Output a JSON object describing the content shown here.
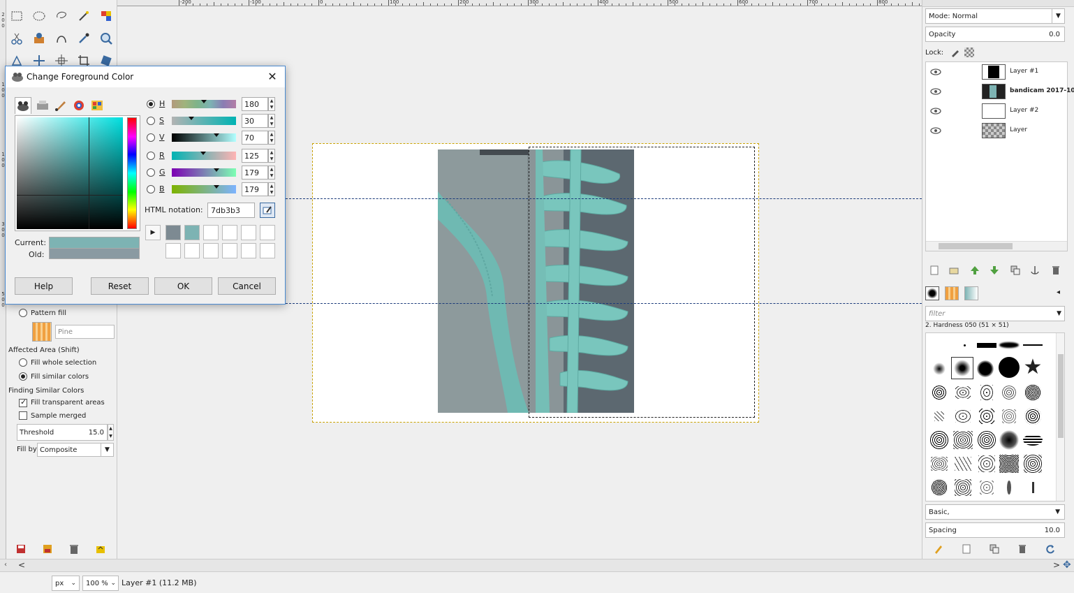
{
  "ruler": {
    "h_ticks": [
      "-200",
      "-100",
      "0",
      "100",
      "200",
      "300",
      "400",
      "500",
      "600",
      "700",
      "800"
    ],
    "v_ticks": [
      "2",
      "0",
      "0",
      "1",
      "0",
      "0",
      "1",
      "0",
      "0",
      "3",
      "0",
      "0",
      "5",
      "0",
      "0"
    ]
  },
  "dialog": {
    "title": "Change Foreground Color",
    "close": "✕",
    "sliders": [
      {
        "label": "H",
        "value": "180",
        "checked": true
      },
      {
        "label": "S",
        "value": "30",
        "checked": false
      },
      {
        "label": "V",
        "value": "70",
        "checked": false
      },
      {
        "label": "R",
        "value": "125",
        "checked": false
      },
      {
        "label": "G",
        "value": "179",
        "checked": false
      },
      {
        "label": "B",
        "value": "179",
        "checked": false
      }
    ],
    "html_notation_label": "HTML notation:",
    "html_notation_value": "7db3b3",
    "current_label": "Current:",
    "old_label": "Old:",
    "current_color": "#7db3b3",
    "old_color": "#8a9aa2",
    "history_colors": [
      "#7d8a92",
      "#7db3b3"
    ],
    "buttons": {
      "help": "Help",
      "reset": "Reset",
      "ok": "OK",
      "cancel": "Cancel"
    }
  },
  "toolbox": {
    "pattern_fill": "Pattern fill",
    "pattern_name": "Pine",
    "affected_area": "Affected Area  (Shift)",
    "fill_whole": "Fill whole selection",
    "fill_similar": "Fill similar colors",
    "finding_similar": "Finding Similar Colors",
    "fill_transparent": "Fill transparent areas",
    "sample_merged": "Sample merged",
    "threshold_label": "Threshold",
    "threshold_value": "15.0",
    "fill_by_label": "Fill by:",
    "fill_by_value": "Composite"
  },
  "dock": {
    "mode": "Mode: Normal",
    "opacity_label": "Opacity",
    "opacity_value": "0.0",
    "lock_label": "Lock:",
    "layers": [
      {
        "name": "Layer #1",
        "active": false
      },
      {
        "name": "bandicam 2017-10",
        "active": true
      },
      {
        "name": "Layer #2",
        "active": false
      },
      {
        "name": "Layer",
        "active": false
      }
    ],
    "filter_placeholder": "filter",
    "brush_name": "2. Hardness 050 (51 × 51)",
    "preset": "Basic,",
    "spacing_label": "Spacing",
    "spacing_value": "10.0"
  },
  "status": {
    "unit": "px",
    "zoom": "100 %",
    "layer_info": "Layer #1 (11.2 MB)"
  },
  "colors": {
    "accent": "#4a8ad0",
    "teal": "#7db3b3"
  }
}
